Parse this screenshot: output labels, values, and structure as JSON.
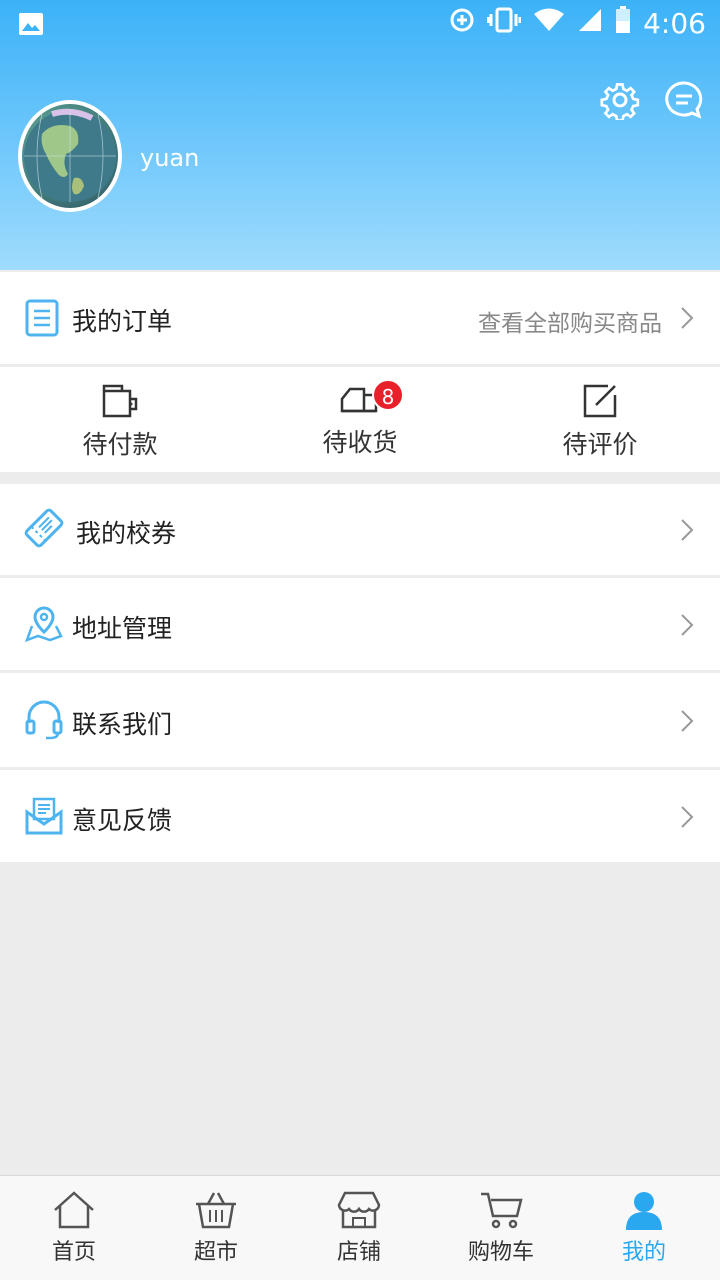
{
  "status_bar": {
    "time": "4:06",
    "icons": [
      "gallery-icon",
      "data-saver-icon",
      "vibrate-icon",
      "wifi-icon",
      "signal-icon",
      "battery-icon"
    ]
  },
  "profile": {
    "username": "yuan"
  },
  "orders": {
    "title": "我的订单",
    "view_all": "查看全部购买商品",
    "statuses": [
      {
        "label": "待付款",
        "icon": "wallet-icon"
      },
      {
        "label": "待收货",
        "icon": "truck-icon",
        "badge": "8"
      },
      {
        "label": "待评价",
        "icon": "edit-icon"
      }
    ]
  },
  "menu": [
    {
      "label": "我的校券",
      "icon": "ticket-icon"
    },
    {
      "label": "地址管理",
      "icon": "location-icon"
    },
    {
      "label": "联系我们",
      "icon": "headset-icon"
    },
    {
      "label": "意见反馈",
      "icon": "mail-icon"
    }
  ],
  "tabbar": {
    "tabs": [
      {
        "label": "首页",
        "icon": "home-icon"
      },
      {
        "label": "超市",
        "icon": "basket-icon"
      },
      {
        "label": "店铺",
        "icon": "store-icon"
      },
      {
        "label": "购物车",
        "icon": "cart-icon"
      },
      {
        "label": "我的",
        "icon": "user-icon",
        "active": true
      }
    ]
  },
  "colors": {
    "accent": "#2aa8ef",
    "header_top": "#3cb2f8",
    "header_bottom": "#9fdcfd",
    "badge": "#e8202a"
  }
}
